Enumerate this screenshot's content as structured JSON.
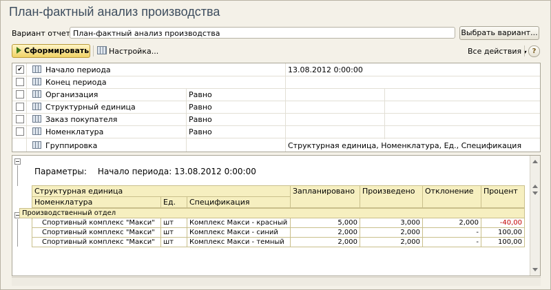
{
  "window": {
    "title": "План-фактный анализ производства"
  },
  "variant": {
    "label": "Вариант отчета:",
    "value": "План-фактный анализ производства",
    "choose_button": "Выбрать вариант..."
  },
  "toolbar": {
    "run_button": "Сформировать",
    "settings_button": "Настройка...",
    "all_actions": "Все действия",
    "help": "?"
  },
  "settings_rows": [
    {
      "checked": true,
      "name": "Начало периода",
      "cond": "",
      "value": "13.08.2012 0:00:00"
    },
    {
      "checked": false,
      "name": "Конец периода",
      "cond": "",
      "value": ""
    },
    {
      "checked": false,
      "name": "Организация",
      "cond": "Равно",
      "value": ""
    },
    {
      "checked": false,
      "name": "Структурный единица",
      "cond": "Равно",
      "value": ""
    },
    {
      "checked": false,
      "name": "Заказ покупателя",
      "cond": "Равно",
      "value": ""
    },
    {
      "checked": false,
      "name": "Номенклатура",
      "cond": "Равно",
      "value": ""
    },
    {
      "checked": null,
      "name": "Группировка",
      "cond": "",
      "value": "Структурная единица, Номенклатура, Ед., Спецификация"
    }
  ],
  "report": {
    "params_label": "Параметры:",
    "params_value": "Начало периода: 13.08.2012 0:00:00",
    "headers": {
      "unit": "Структурная единица",
      "nomen": "Номенклатура",
      "ed": "Ед.",
      "spec": "Спецификация",
      "planned": "Запланировано",
      "produced": "Произведено",
      "deviation": "Отклонение",
      "percent": "Процент"
    },
    "group_name": "Производственный отдел",
    "rows": [
      {
        "nomen": "Спортивный комплекс \"Макси\"",
        "ed": "шт",
        "spec": "Комплекс Макси - красный",
        "planned": "5,000",
        "produced": "3,000",
        "deviation": "2,000",
        "percent": "-40,00"
      },
      {
        "nomen": "Спортивный комплекс \"Макси\"",
        "ed": "шт",
        "spec": "Комплекс Макси - синий",
        "planned": "2,000",
        "produced": "2,000",
        "deviation": "-",
        "percent": "100,00"
      },
      {
        "nomen": "Спортивный комплекс \"Макси\"",
        "ed": "шт",
        "spec": "Комплекс Макси - темный",
        "planned": "2,000",
        "produced": "2,000",
        "deviation": "-",
        "percent": "100,00"
      }
    ]
  }
}
